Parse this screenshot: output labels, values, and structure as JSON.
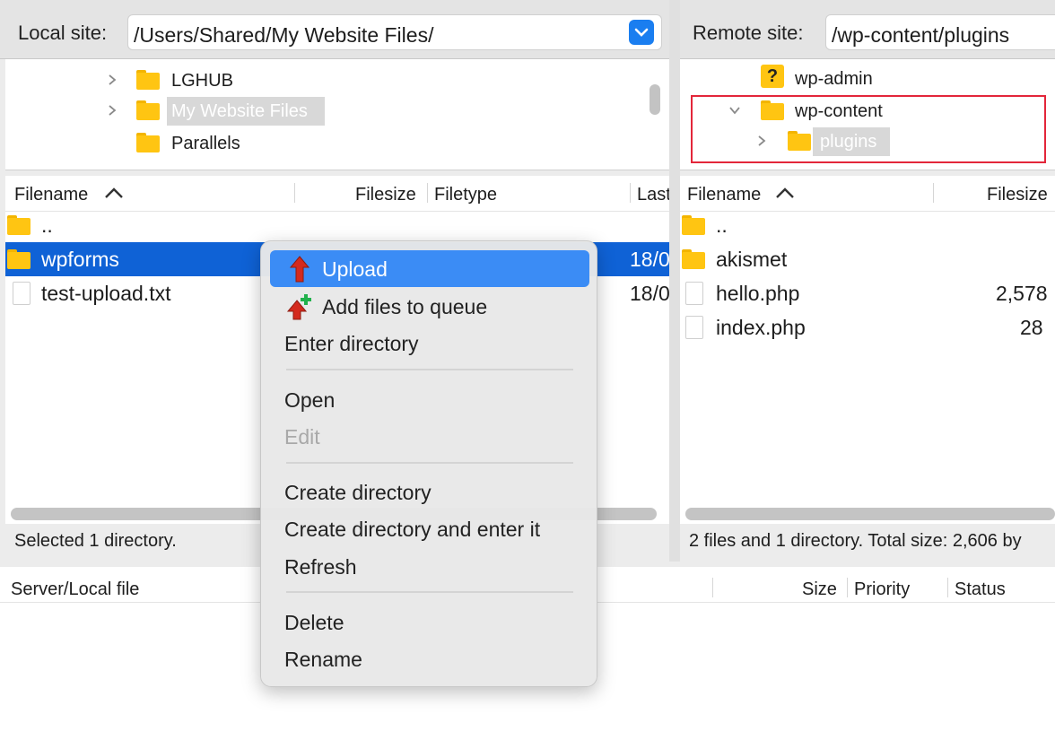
{
  "local": {
    "label": "Local site:",
    "path": "/Users/Shared/My Website Files/",
    "tree": [
      "LGHUB",
      "My Website Files",
      "Parallels"
    ],
    "columns": [
      "Filename",
      "Filesize",
      "Filetype",
      "Last"
    ],
    "rows": [
      {
        "name": "..",
        "date": ""
      },
      {
        "name": "wpforms",
        "date": "18/0"
      },
      {
        "name": "test-upload.txt",
        "date": "18/0"
      }
    ],
    "status": "Selected 1 directory."
  },
  "remote": {
    "label": "Remote site:",
    "path": "/wp-content/plugins",
    "tree": [
      "wp-admin",
      "wp-content",
      "plugins"
    ],
    "columns": [
      "Filename",
      "Filesize"
    ],
    "rows": [
      {
        "name": "..",
        "size": ""
      },
      {
        "name": "akismet",
        "size": ""
      },
      {
        "name": "hello.php",
        "size": "2,578"
      },
      {
        "name": "index.php",
        "size": "28"
      }
    ],
    "status": "2 files and 1 directory. Total size: 2,606 by"
  },
  "queue": {
    "columns": [
      "Server/Local file",
      "Size",
      "Priority",
      "Status"
    ]
  },
  "menu": {
    "items": [
      "Upload",
      "Add files to queue",
      "Enter directory",
      "Open",
      "Edit",
      "Create directory",
      "Create directory and enter it",
      "Refresh",
      "Delete",
      "Rename"
    ]
  },
  "colors": {
    "selection": "#0f62d6",
    "menu_highlight": "#3b8cf5",
    "folder": "#ffc512",
    "annotation_box": "#e3263a"
  }
}
